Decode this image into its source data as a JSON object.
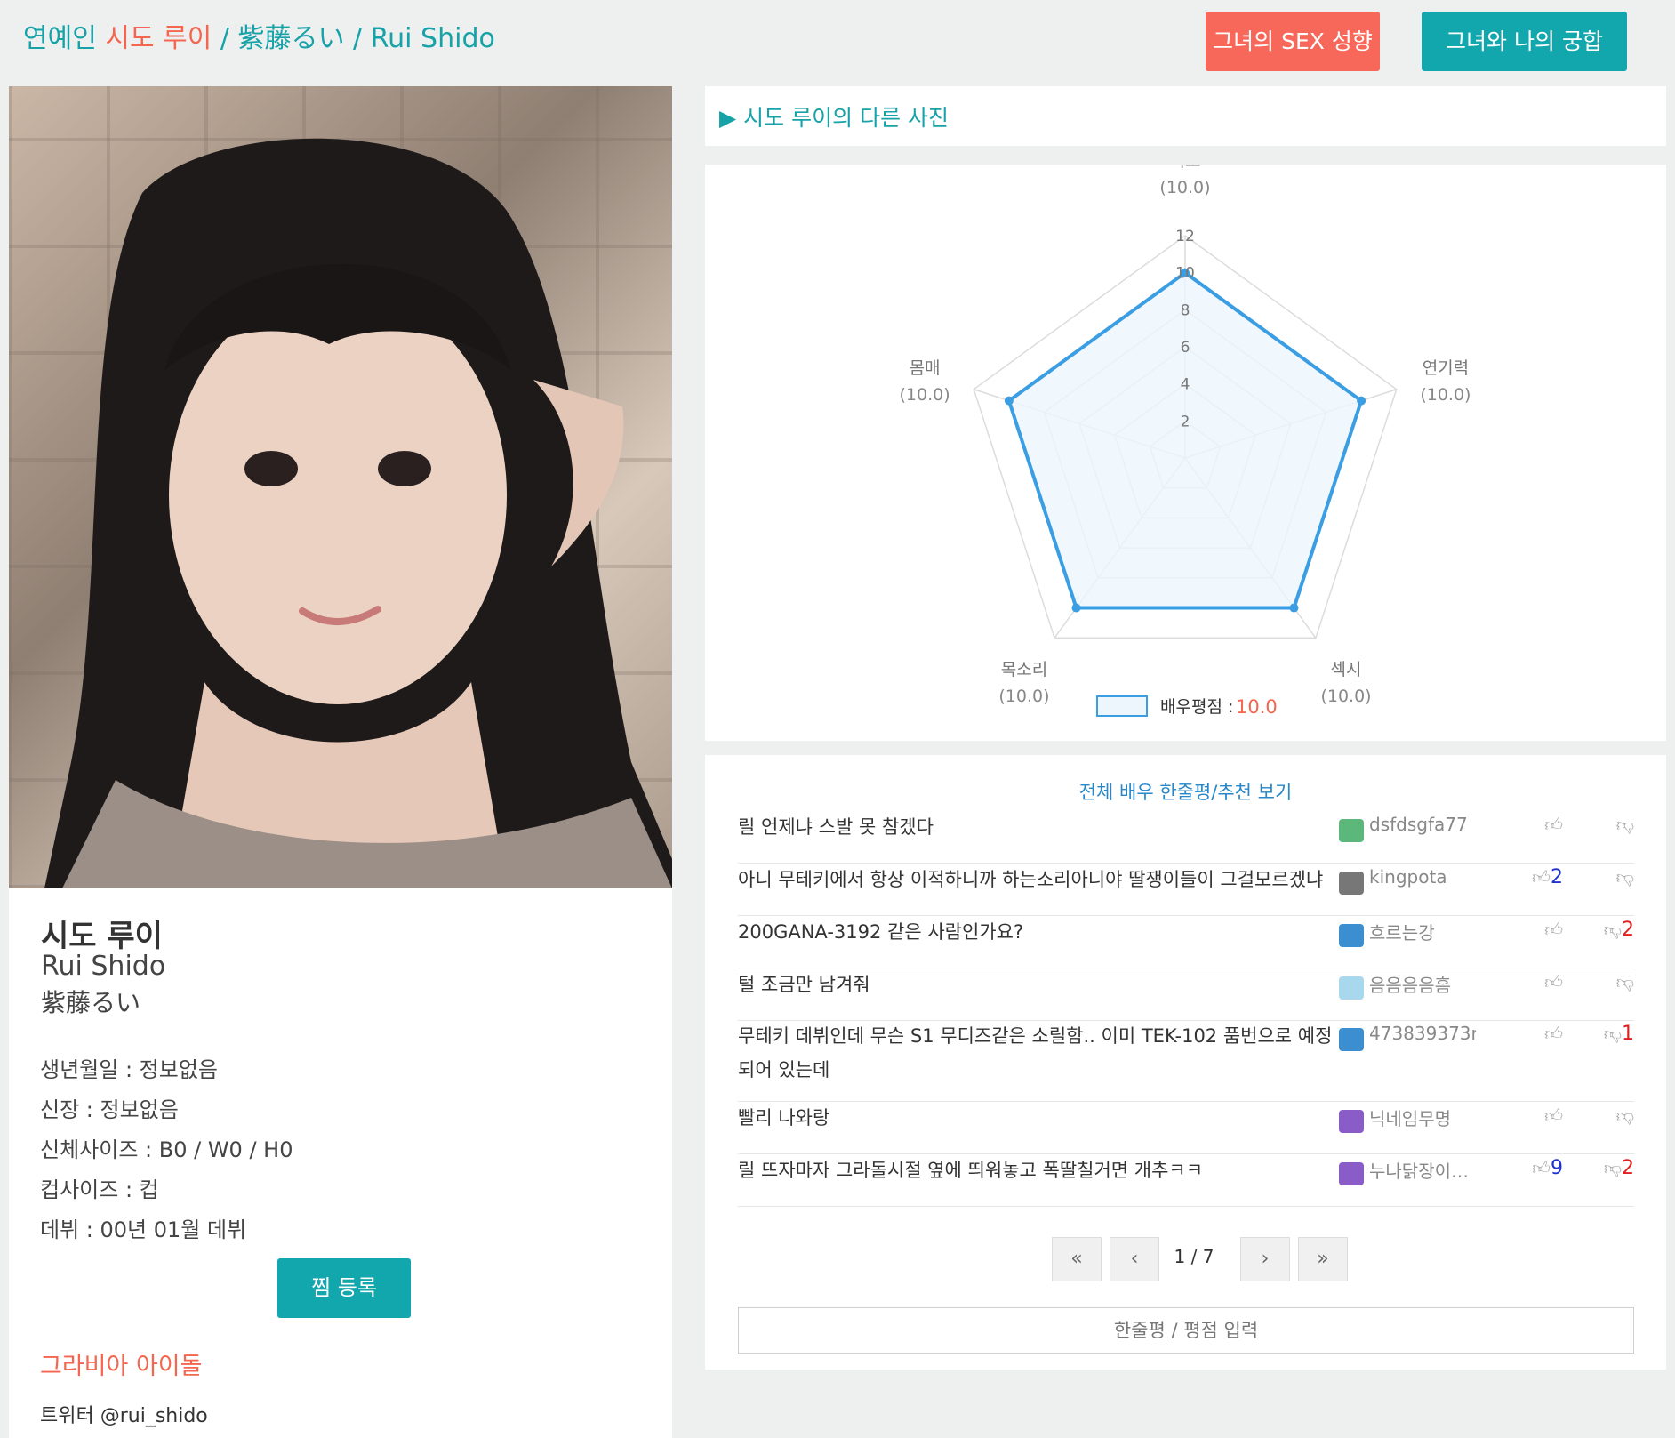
{
  "header": {
    "prefix": "연예인",
    "name": "시도 루이",
    "rest": "/ 紫藤るい / Rui Shido",
    "btn_sex": "그녀의 SEX 성향",
    "btn_compat": "그녀와 나의 궁합"
  },
  "profile": {
    "name_ko": "시도 루이",
    "name_en": "Rui Shido",
    "name_jp": "紫藤るい",
    "birth": "생년월일 : 정보없음",
    "height": "신장 : 정보없음",
    "body": "신체사이즈 : B0 / W0 / H0",
    "cup": "컵사이즈 : 컵",
    "debut": "데뷔 : 00년 01월 데뷔",
    "zzim": "찜 등록",
    "category": "그라비아 아이돌",
    "twitter": "트위터 @rui_shido"
  },
  "photos_link": "▶ 시도 루이의 다른 사진",
  "chart_data": {
    "type": "radar",
    "categories": [
      "외모",
      "연기력",
      "섹시",
      "목소리",
      "몸매"
    ],
    "category_scores": [
      "(10.0)",
      "(10.0)",
      "(10.0)",
      "(10.0)",
      "(10.0)"
    ],
    "values": [
      10,
      10,
      10,
      10,
      10
    ],
    "r_ticks": [
      "2",
      "4",
      "6",
      "8",
      "10",
      "12"
    ],
    "r_max": 12,
    "legend_label": "배우평점 : ",
    "legend_value": "10.0",
    "colors": {
      "line": "#3b9ee3",
      "fill": "#eef6fd",
      "grid": "#dcdcdc"
    }
  },
  "reviews": {
    "all_link": "전체 배우 한줄평/추천 보기",
    "items": [
      {
        "text": "릴 언제냐 스발 못 참겠다",
        "user": "dsfdsgfa77",
        "up": "",
        "down": "",
        "icon_color": "#5cb87a"
      },
      {
        "text": "아니 무테키에서 항상 이적하니까 하는소리아니야 딸쟁이들이 그걸모르겠냐",
        "user": "kingpota",
        "up": "2",
        "down": "",
        "icon_color": "#777777"
      },
      {
        "text": "200GANA-3192 같은 사람인가요?",
        "user": "흐르는강",
        "up": "",
        "down": "2",
        "icon_color": "#3b8ed0"
      },
      {
        "text": "털 조금만 남겨줘",
        "user": "음음음음흠",
        "up": "",
        "down": "",
        "icon_color": "#a8d8ee"
      },
      {
        "text": "무테키 데뷔인데 무슨 S1 무디즈같은 소릴함.. 이미 TEK-102 품번으로 예정되어 있는데",
        "user": "473839373r",
        "up": "",
        "down": "1",
        "icon_color": "#3b8ed0"
      },
      {
        "text": "빨리 나와랑",
        "user": "닉네임무명",
        "up": "",
        "down": "",
        "icon_color": "#8a5cc8"
      },
      {
        "text": "릴 뜨자마자 그라돌시절 옆에 띄워놓고 폭딸칠거면 개추ㅋㅋ",
        "user": "누나닭장이…",
        "up": "9",
        "down": "2",
        "icon_color": "#8a5cc8"
      }
    ],
    "pagination": {
      "first": "«",
      "prev": "‹",
      "info": "1 / 7",
      "next": "›",
      "last": "»"
    },
    "input_label": "한줄평 / 평점 입력"
  }
}
